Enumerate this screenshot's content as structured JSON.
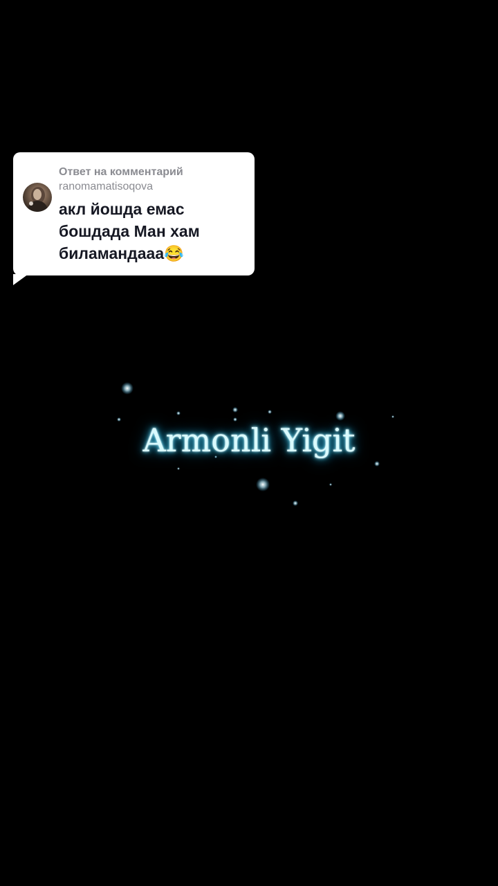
{
  "reply": {
    "header": "Ответ на комментарий",
    "username": "ranomamatisoqova",
    "comment": "акл йошда емас бошдада Ман хам биламандааа😂"
  },
  "video": {
    "title": "Armonli Yigit"
  }
}
